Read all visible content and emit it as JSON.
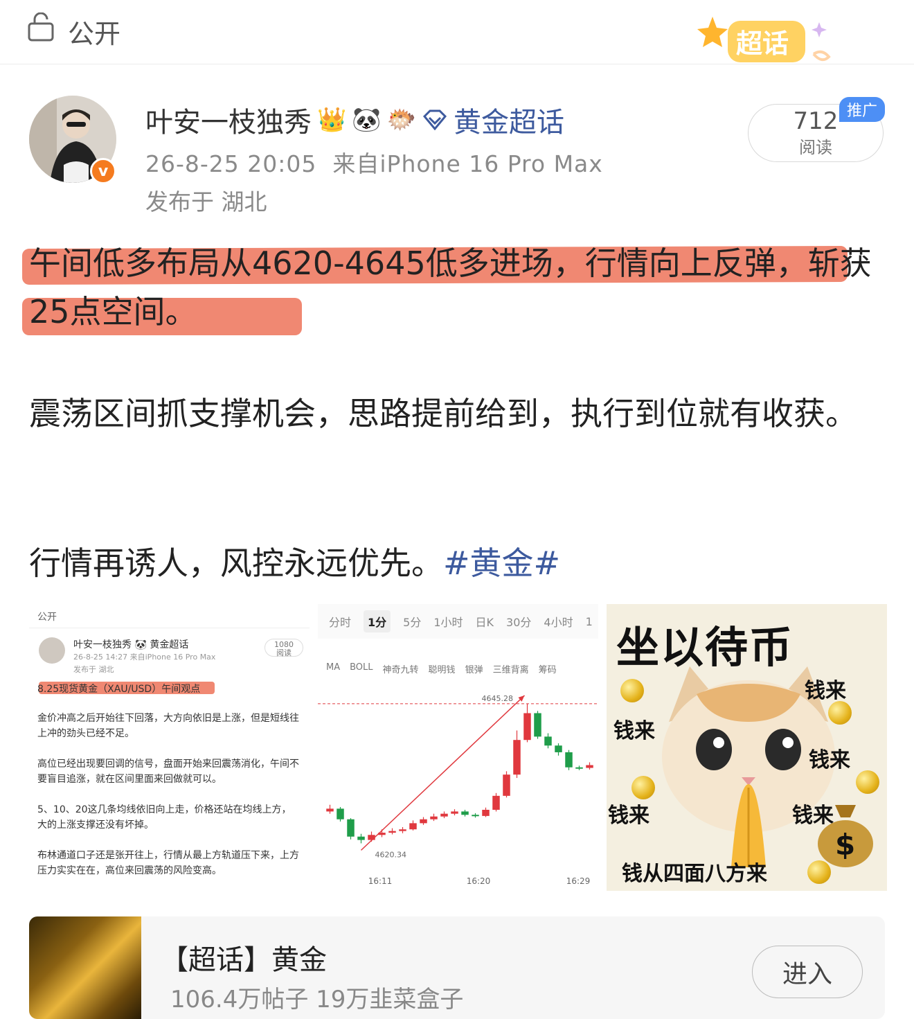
{
  "header": {
    "visibility_label": "公开",
    "super_topic_badge": "超话"
  },
  "post": {
    "author_name": "叶安一枝独秀",
    "badges": [
      "crown-badge",
      "panda-badge",
      "fish-badge"
    ],
    "topic_link": "黄金超话",
    "timestamp": "26-8-25 20:05",
    "source": "来自iPhone 16 Pro Max",
    "location": "发布于 湖北",
    "reads_count": "712",
    "reads_label": "阅读",
    "promo_tag": "推广",
    "paragraph1": "午间低多布局从4620-4645低多进场，行情向上反弹，斩获25点空间。",
    "paragraph2": "震荡区间抓支撑机会，思路提前给到，执行到位就有收获。",
    "paragraph3_text": "行情再诱人，风控永远优先。",
    "paragraph3_tag": "#黄金#"
  },
  "thumb1": {
    "visibility": "公开",
    "author": "叶安一枝独秀 🐼 黄金超话",
    "meta": "26-8-25 14:27 来自iPhone 16 Pro Max",
    "location": "发布于 湖北",
    "reads": "1080\n阅读",
    "title": "8.25现货黄金（XAU/USD）午间观点",
    "p1": "金价冲高之后开始往下回落，大方向依旧是上涨，但是短线往上冲的劲头已经不足。",
    "p2": "高位已经出现要回调的信号，盘面开始来回震荡消化，午间不要盲目追涨，就在区间里面来回做就可以。",
    "p3": "5、10、20这几条均线依旧向上走，价格还站在均线上方，大的上涨支撑还没有坏掉。",
    "p4": "布林通道口子还是张开往上，行情从最上方轨道压下来，上方压力实实在在，高位来回震荡的风险变高。"
  },
  "thumb2": {
    "tabs": [
      "分时",
      "1分",
      "5分",
      "1小时",
      "日K",
      "30分",
      "4小时",
      "1"
    ],
    "active_tab": "1分",
    "indicators": [
      "MA",
      "BOLL",
      "神奇九转",
      "聪明钱",
      "银弹",
      "三维背离",
      "筹码"
    ],
    "high_label": "4645.28",
    "low_label": "4620.34",
    "time_labels": [
      "16:11",
      "16:20",
      "16:29"
    ]
  },
  "chart_data": {
    "type": "candlestick",
    "xlabel": "",
    "ylabel": "",
    "annotations": [
      "4645.28",
      "4620.34"
    ],
    "x_ticks": [
      "16:11",
      "16:20",
      "16:29"
    ],
    "candles": [
      {
        "o": 4626.0,
        "c": 4626.5,
        "h": 4627.2,
        "l": 4625.6
      },
      {
        "o": 4626.5,
        "c": 4624.6,
        "h": 4626.8,
        "l": 4624.2
      },
      {
        "o": 4624.6,
        "c": 4621.5,
        "h": 4624.8,
        "l": 4621.0
      },
      {
        "o": 4621.5,
        "c": 4620.9,
        "h": 4622.0,
        "l": 4620.3
      },
      {
        "o": 4620.9,
        "c": 4621.8,
        "h": 4622.4,
        "l": 4620.6
      },
      {
        "o": 4621.8,
        "c": 4622.2,
        "h": 4622.8,
        "l": 4621.4
      },
      {
        "o": 4622.2,
        "c": 4622.5,
        "h": 4623.0,
        "l": 4621.9
      },
      {
        "o": 4622.5,
        "c": 4622.8,
        "h": 4623.2,
        "l": 4622.1
      },
      {
        "o": 4622.8,
        "c": 4623.9,
        "h": 4624.4,
        "l": 4622.6
      },
      {
        "o": 4623.9,
        "c": 4624.6,
        "h": 4625.0,
        "l": 4623.6
      },
      {
        "o": 4624.6,
        "c": 4625.1,
        "h": 4625.6,
        "l": 4624.3
      },
      {
        "o": 4625.1,
        "c": 4625.6,
        "h": 4626.0,
        "l": 4624.8
      },
      {
        "o": 4625.6,
        "c": 4626.0,
        "h": 4626.4,
        "l": 4625.3
      },
      {
        "o": 4626.0,
        "c": 4625.4,
        "h": 4626.3,
        "l": 4625.1
      },
      {
        "o": 4625.4,
        "c": 4625.2,
        "h": 4625.7,
        "l": 4624.9
      },
      {
        "o": 4625.2,
        "c": 4626.3,
        "h": 4626.7,
        "l": 4625.0
      },
      {
        "o": 4626.3,
        "c": 4628.8,
        "h": 4629.3,
        "l": 4626.0
      },
      {
        "o": 4628.8,
        "c": 4632.6,
        "h": 4633.2,
        "l": 4628.5
      },
      {
        "o": 4632.6,
        "c": 4638.8,
        "h": 4640.5,
        "l": 4632.0
      },
      {
        "o": 4638.8,
        "c": 4643.6,
        "h": 4645.28,
        "l": 4638.4
      },
      {
        "o": 4643.6,
        "c": 4639.4,
        "h": 4644.0,
        "l": 4639.0
      },
      {
        "o": 4639.4,
        "c": 4637.8,
        "h": 4640.0,
        "l": 4637.3
      },
      {
        "o": 4637.8,
        "c": 4636.6,
        "h": 4638.2,
        "l": 4636.0
      },
      {
        "o": 4636.6,
        "c": 4633.9,
        "h": 4637.0,
        "l": 4633.4
      },
      {
        "o": 4633.9,
        "c": 4633.8,
        "h": 4634.2,
        "l": 4633.4
      },
      {
        "o": 4633.8,
        "c": 4634.3,
        "h": 4634.8,
        "l": 4633.5
      }
    ],
    "ylim": [
      4617,
      4648
    ],
    "up_color": "#e0383e",
    "down_color": "#1f9d4a"
  },
  "thumb3": {
    "title": "坐以待币",
    "labels": [
      "钱来",
      "钱来",
      "钱来",
      "钱来",
      "钱来"
    ],
    "bottom": "钱从四面八方来"
  },
  "topic_card": {
    "title": "【超话】黄金",
    "stats": "106.4万帖子 19万韭菜盒子",
    "enter_label": "进入"
  },
  "colors": {
    "topic_blue": "#3d5a9e",
    "highlight": "#f08872",
    "promo_blue": "#4d8ff5",
    "verify_orange": "#f57b1f"
  }
}
